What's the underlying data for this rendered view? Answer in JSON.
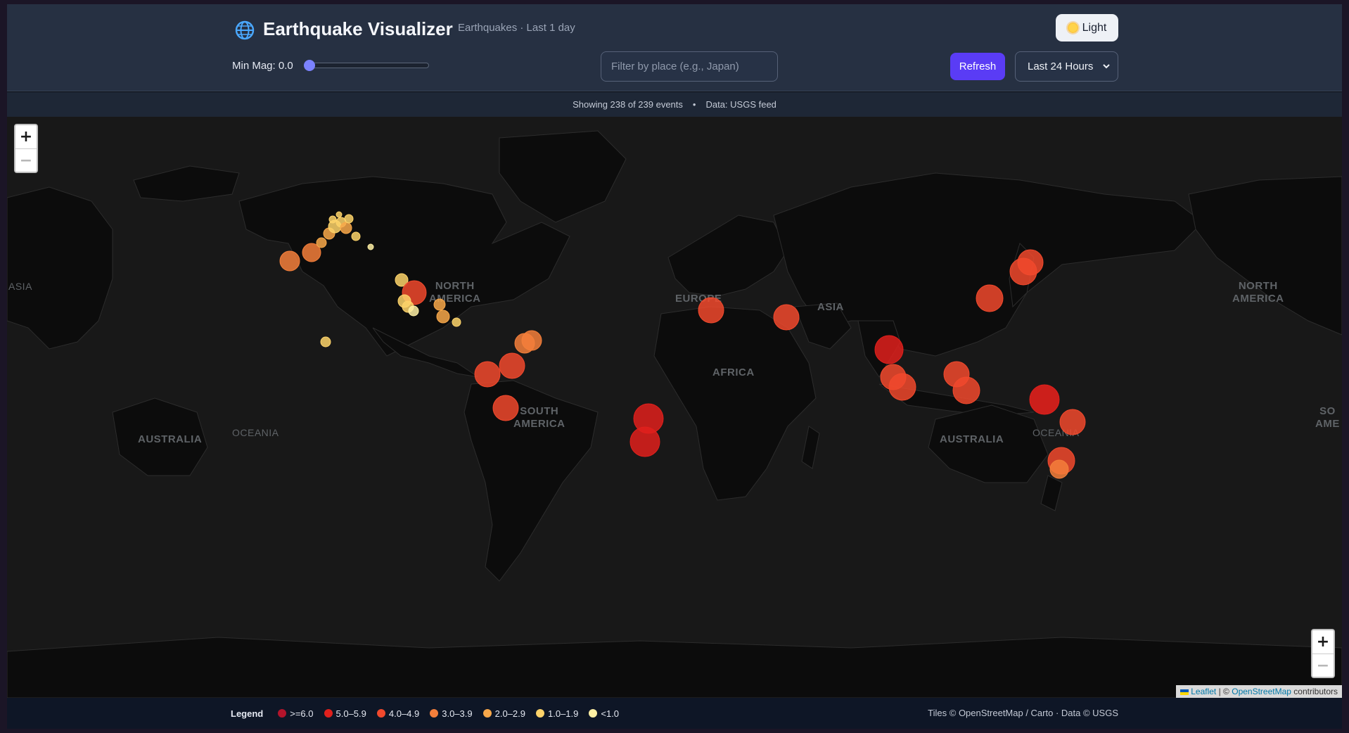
{
  "header": {
    "title": "Earthquake Visualizer",
    "subtitle": "Earthquakes · Last 1 day",
    "theme_button_label": "Light",
    "min_mag_label": "Min Mag: 0.0",
    "min_mag_value": 0.0,
    "filter_placeholder": "Filter by place (e.g., Japan)",
    "refresh_label": "Refresh",
    "range_selected": "Last 24 Hours"
  },
  "status": {
    "showing": "Showing 238 of 239 events",
    "separator": "•",
    "source": "Data: USGS feed"
  },
  "map": {
    "labels": {
      "asia_left": "ASIA",
      "north_america": "NORTH\nAMERICA",
      "europe": "EUROPE",
      "asia": "ASIA",
      "north_america_right": "NORTH\nAMERICA",
      "africa": "AFRICA",
      "south_america": "SOUTH\nAMERICA",
      "south_america_right": "SO\nAME",
      "australia_left": "AUSTRALIA",
      "oceania_left": "OCEANIA",
      "australia": "AUSTRALIA",
      "oceania": "OCEANIA"
    },
    "zoom_in": "+",
    "zoom_out": "−",
    "attribution": {
      "leaflet": "Leaflet",
      "sep": "| ©",
      "osm": "OpenStreetMap",
      "contributors": "contributors"
    }
  },
  "legend": {
    "title": "Legend",
    "items": [
      {
        "label": ">=6.0",
        "color": "#b3142b"
      },
      {
        "label": "5.0–5.9",
        "color": "#e0201c"
      },
      {
        "label": "4.0–4.9",
        "color": "#f1492d"
      },
      {
        "label": "3.0–3.9",
        "color": "#f47f3b"
      },
      {
        "label": "2.0–2.9",
        "color": "#f8a84a"
      },
      {
        "label": "1.0–1.9",
        "color": "#fdd36a"
      },
      {
        "label": "<1.0",
        "color": "#fef0a4"
      }
    ]
  },
  "footer": {
    "credit": "Tiles © OpenStreetMap / Carto · Data © USGS"
  }
}
